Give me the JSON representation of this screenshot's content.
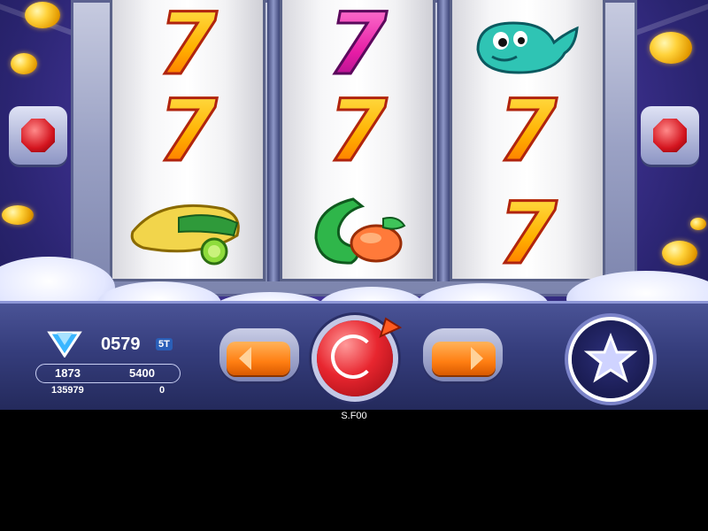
{
  "hud": {
    "credits": "0579",
    "credits_badge": "5T",
    "bet_left": "1873",
    "bet_right": "5400",
    "win_left": "135979",
    "win_right": "0",
    "footer": "S.F00"
  },
  "reels": [
    [
      "seven-orange",
      "seven-orange",
      "banana-lime"
    ],
    [
      "seven-pink",
      "seven-orange",
      "green-fruit"
    ],
    [
      "whale",
      "seven-orange",
      "seven-orange"
    ]
  ],
  "symbols": {
    "seven": "7"
  },
  "colors": {
    "background": "#2a2470",
    "console": "#353d7c",
    "spin_button": "#e8262f",
    "arrow_buttons": "#ff7e12",
    "seven_fill": "#ffb000",
    "seven_pink": "#e61ca5"
  },
  "icons": [
    "diamond-icon",
    "star-icon",
    "spin-arrow-icon",
    "left-arrow-icon",
    "right-arrow-icon",
    "ruby-gem-icon"
  ]
}
